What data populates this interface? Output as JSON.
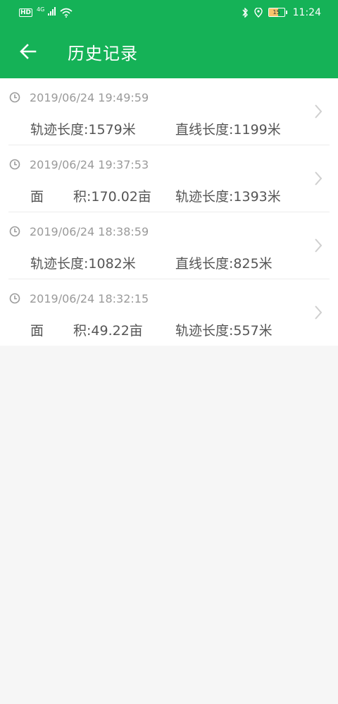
{
  "status_bar": {
    "hd": "HD",
    "network": "4G",
    "battery_level": "15",
    "time": "11:24"
  },
  "header": {
    "title": "历史记录"
  },
  "records": [
    {
      "time": "2019/06/24 19:49:59",
      "col1": "轨迹长度:1579米",
      "col2": "直线长度:1199米"
    },
    {
      "time": "2019/06/24 19:37:53",
      "col1_label_a": "面",
      "col1_label_b": "积:170.02亩",
      "col2": "轨迹长度:1393米"
    },
    {
      "time": "2019/06/24 18:38:59",
      "col1": "轨迹长度:1082米",
      "col2": "直线长度:825米"
    },
    {
      "time": "2019/06/24 18:32:15",
      "col1_label_a": "面",
      "col1_label_b": "积:49.22亩",
      "col2": "轨迹长度:557米"
    }
  ],
  "colors": {
    "brand": "#15b257",
    "time_text": "#9a9a9a",
    "info_text": "#555555"
  }
}
